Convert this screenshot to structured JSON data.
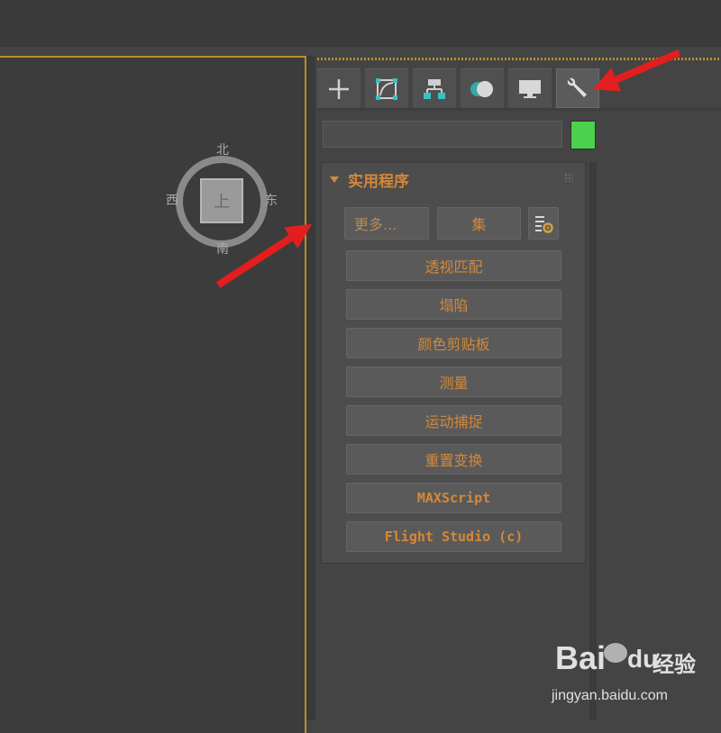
{
  "viewcube": {
    "top_face": "上",
    "north": "北",
    "south": "南",
    "west": "西",
    "east": "东"
  },
  "command_panel": {
    "tabs": [
      {
        "icon": "plus-icon",
        "name": "create"
      },
      {
        "icon": "curve-edit-icon",
        "name": "modify"
      },
      {
        "icon": "hierarchy-icon",
        "name": "hierarchy"
      },
      {
        "icon": "motion-icon",
        "name": "motion"
      },
      {
        "icon": "monitor-icon",
        "name": "display"
      },
      {
        "icon": "wrench-icon",
        "name": "utilities",
        "active": true
      }
    ],
    "name_field_value": "",
    "color_swatch": "#4cd14c"
  },
  "utilities_rollout": {
    "title": "实用程序",
    "more_button": "更多...",
    "sets_button": "集",
    "buttons": [
      "透视匹配",
      "塌陷",
      "颜色剪贴板",
      "测量",
      "运动捕捉",
      "重置变换",
      "MAXScript",
      "Flight Studio (c)"
    ]
  },
  "colors": {
    "accent_orange": "#d4883a",
    "viewport_border": "#b88f2a",
    "annotation_arrow": "#e31e1e"
  },
  "watermark": {
    "logo": "Bai",
    "logo_suffix": "du",
    "product": "经验",
    "url": "jingyan.baidu.com"
  }
}
